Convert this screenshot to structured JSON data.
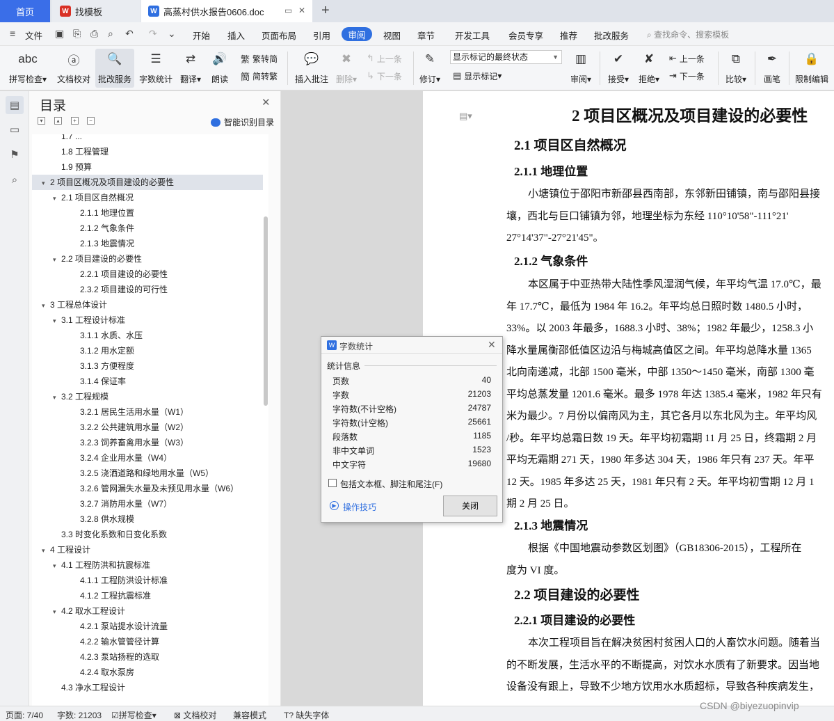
{
  "tabs": {
    "home": "首页",
    "template": "找模板",
    "doc": "高蒸村供水报告0606.doc",
    "add": "+"
  },
  "menu": {
    "file": "文件",
    "items": [
      "开始",
      "插入",
      "页面布局",
      "引用",
      "审阅",
      "视图",
      "章节",
      "开发工具",
      "会员专享",
      "推荐",
      "批改服务"
    ],
    "search": "查找命令、搜索模板"
  },
  "ribbon": {
    "spellcheck": "拼写检查",
    "doc_proof": "文档校对",
    "correction": "批改服务",
    "word_count": "字数统计",
    "translate": "翻译",
    "read_aloud": "朗读",
    "to_traditional": "繁转简",
    "to_simplified": "简转繁",
    "insert_comment": "插入批注",
    "delete": "删除",
    "prev": "上一条",
    "next": "下一条",
    "track": "修订",
    "markup_state": "显示标记的最终状态",
    "show_markup": "显示标记",
    "review_pane": "审阅",
    "accept": "接受",
    "reject": "拒绝",
    "prev2": "上一条",
    "next2": "下一条",
    "compare": "比较",
    "pen": "画笔",
    "restrict": "限制编辑"
  },
  "toc": {
    "title": "目录",
    "smart": "智能识别目录",
    "items": [
      {
        "text": "1.7 ...",
        "level": 2,
        "toggle": ""
      },
      {
        "text": "1.8  工程管理",
        "level": 2,
        "toggle": ""
      },
      {
        "text": "1.9  预算",
        "level": 2,
        "toggle": ""
      },
      {
        "text": "2  项目区概况及项目建设的必要性",
        "level": 1,
        "toggle": "▾"
      },
      {
        "text": "2.1  项目区自然概况",
        "level": 2,
        "toggle": "▾"
      },
      {
        "text": "2.1.1  地理位置",
        "level": 3,
        "toggle": ""
      },
      {
        "text": "2.1.2  气象条件",
        "level": 3,
        "toggle": ""
      },
      {
        "text": "2.1.3  地震情况",
        "level": 3,
        "toggle": ""
      },
      {
        "text": "2.2  项目建设的必要性",
        "level": 2,
        "toggle": "▾"
      },
      {
        "text": "2.2.1  项目建设的必要性",
        "level": 3,
        "toggle": ""
      },
      {
        "text": "2.3.2  项目建设的可行性",
        "level": 3,
        "toggle": ""
      },
      {
        "text": "3  工程总体设计",
        "level": 1,
        "toggle": "▾"
      },
      {
        "text": "3.1  工程设计标准",
        "level": 2,
        "toggle": "▾"
      },
      {
        "text": "3.1.1  水质、水压",
        "level": 3,
        "toggle": ""
      },
      {
        "text": "3.1.2  用水定额",
        "level": 3,
        "toggle": ""
      },
      {
        "text": "3.1.3  方便程度",
        "level": 3,
        "toggle": ""
      },
      {
        "text": "3.1.4  保证率",
        "level": 3,
        "toggle": ""
      },
      {
        "text": "3.2  工程规模",
        "level": 2,
        "toggle": "▾"
      },
      {
        "text": "3.2.1  居民生活用水量（W1）",
        "level": 3,
        "toggle": ""
      },
      {
        "text": "3.2.2  公共建筑用水量（W2）",
        "level": 3,
        "toggle": ""
      },
      {
        "text": "3.2.3  饲养畜禽用水量（W3）",
        "level": 3,
        "toggle": ""
      },
      {
        "text": "3.2.4  企业用水量（W4）",
        "level": 3,
        "toggle": ""
      },
      {
        "text": "3.2.5  浇洒道路和绿地用水量（W5）",
        "level": 3,
        "toggle": ""
      },
      {
        "text": "3.2.6  管网漏失水量及未预见用水量（W6）",
        "level": 3,
        "toggle": ""
      },
      {
        "text": "3.2.7  消防用水量（W7）",
        "level": 3,
        "toggle": ""
      },
      {
        "text": "3.2.8  供水规模",
        "level": 3,
        "toggle": ""
      },
      {
        "text": "3.3  时变化系数和日变化系数",
        "level": 2,
        "toggle": ""
      },
      {
        "text": "4  工程设计",
        "level": 1,
        "toggle": "▾"
      },
      {
        "text": "4.1  工程防洪和抗震标准",
        "level": 2,
        "toggle": "▾"
      },
      {
        "text": "4.1.1  工程防洪设计标准",
        "level": 3,
        "toggle": ""
      },
      {
        "text": "4.1.2  工程抗震标准",
        "level": 3,
        "toggle": ""
      },
      {
        "text": "4.2  取水工程设计",
        "level": 2,
        "toggle": "▾"
      },
      {
        "text": "4.2.1  泵站提水设计流量",
        "level": 3,
        "toggle": ""
      },
      {
        "text": "4.2.2  输水管管径计算",
        "level": 3,
        "toggle": ""
      },
      {
        "text": "4.2.3  泵站扬程的选取",
        "level": 3,
        "toggle": ""
      },
      {
        "text": "4.2.4  取水泵房",
        "level": 3,
        "toggle": ""
      },
      {
        "text": "4.3  净水工程设计",
        "level": 2,
        "toggle": ""
      }
    ]
  },
  "doc": {
    "h1": "2  项目区概况及项目建设的必要性",
    "h2_1": "2.1  项目区自然概况",
    "h3_1": "2.1.1  地理位置",
    "p1": [
      "小塘镇位于邵阳市新邵县西南部，东邻新田铺镇，南与邵阳县接",
      "壤，西北与巨口铺镇为邻，地理坐标为东经 110°10'58\"-111°21'",
      "27°14'37\"-27°21'45\"。"
    ],
    "h3_2": "2.1.2  气象条件",
    "p2": [
      "本区属于中亚热带大陆性季风湿润气候，年平均气温 17.0℃，最",
      "年 17.7℃，最低为 1984 年 16.2。年平均总日照时数 1480.5 小时，",
      "33%。以 2003 年最多，1688.3 小时、38%；1982 年最少，1258.3 小",
      "降水量属衡邵低值区边沿与梅城高值区之间。年平均总降水量 1365",
      "北向南递减，北部 1500 毫米，中部 1350～1450 毫米，南部 1300 毫",
      "平均总蒸发量 1201.6 毫米。最多 1978 年达 1385.4 毫米，1982 年只有",
      "米为最少。7 月份以偏南风为主，其它各月以东北风为主。年平均风",
      "/秒。年平均总霜日数 19 天。年平均初霜期 11 月 25 日，终霜期 2 月",
      "平均无霜期 271 天，1980 年多达 304 天，1986 年只有 237 天。年平",
      "12 天。1985 年多达 25 天，1981 年只有 2 天。年平均初雪期 12 月 1",
      "期 2 月 25 日。"
    ],
    "h3_3": "2.1.3  地震情况",
    "p3": [
      "根据《中国地震动参数区划图》（GB18306-2015），工程所在",
      "度为 VI 度。"
    ],
    "h2_2": "2.2  项目建设的必要性",
    "h3_4": "2.2.1  项目建设的必要性",
    "p4": [
      "本次工程项目旨在解决贫困村贫困人口的人畜饮水问题。随着当",
      "的不断发展，生活水平的不断提高，对饮水水质有了新要求。因当地",
      "设备没有跟上，导致不少地方饮用水水质超标，导致各种疾病发生，"
    ]
  },
  "dialog": {
    "title": "字数统计",
    "section": "统计信息",
    "stats": [
      {
        "k": "页数",
        "v": "40"
      },
      {
        "k": "字数",
        "v": "21203"
      },
      {
        "k": "字符数(不计空格)",
        "v": "24787"
      },
      {
        "k": "字符数(计空格)",
        "v": "25661"
      },
      {
        "k": "段落数",
        "v": "1185"
      },
      {
        "k": "非中文单词",
        "v": "1523"
      },
      {
        "k": "中文字符",
        "v": "19680"
      }
    ],
    "include": "包括文本框、脚注和尾注(F)",
    "tips": "操作技巧",
    "close": "关闭"
  },
  "status": {
    "page": "页面: 7/40",
    "words": "字数: 21203",
    "spell": "拼写检查",
    "proof": "文档校对",
    "compat": "兼容模式",
    "missing_font": "缺失字体"
  },
  "watermark": "CSDN @biyezuopinvip",
  "colors": {
    "accent": "#2f6fe0",
    "home_tab": "#3a6ee8"
  }
}
